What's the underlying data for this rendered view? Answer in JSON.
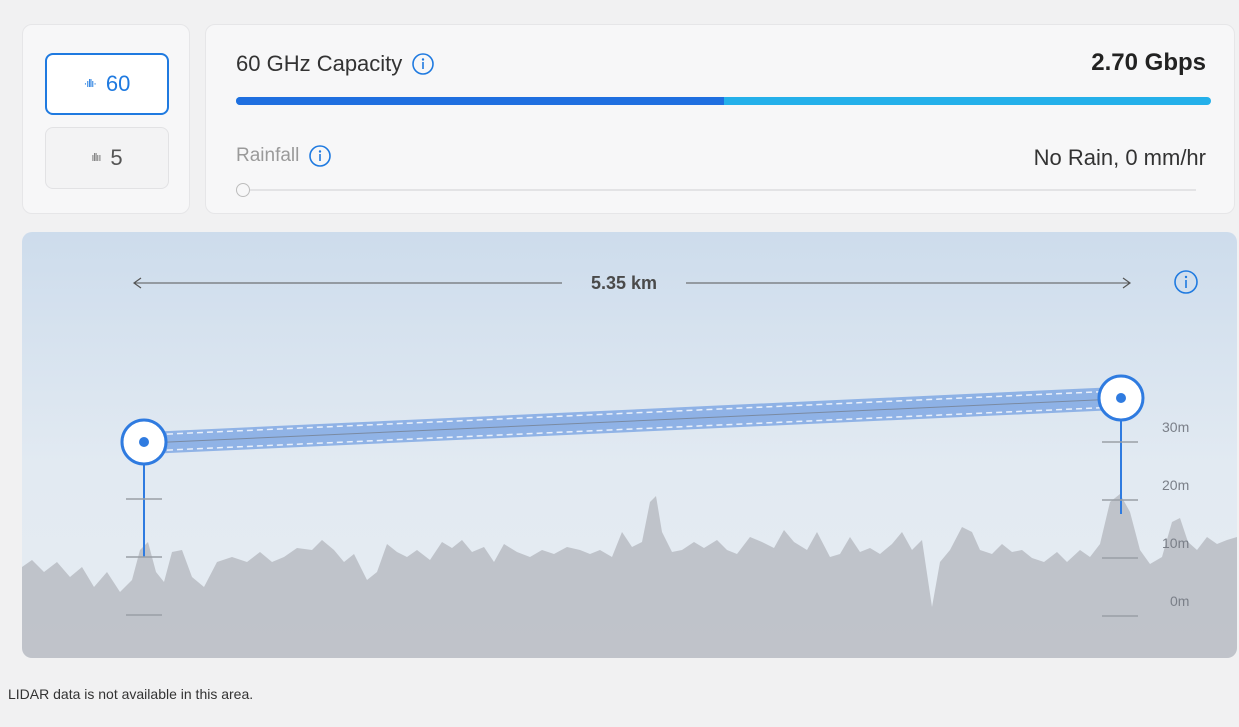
{
  "bands": {
    "band_60": {
      "label": "60",
      "icon": "signal-wave-icon",
      "selected": true
    },
    "band_5": {
      "label": "5",
      "icon": "signal-wave-icon",
      "selected": false
    }
  },
  "capacity": {
    "title": "60 GHz Capacity",
    "value": "2.70 Gbps",
    "bar_primary_fraction": 0.5
  },
  "rainfall": {
    "title": "Rainfall",
    "value": "No Rain, 0 mm/hr",
    "slider_fraction": 0
  },
  "profile": {
    "distance": "5.35 km",
    "height_labels": [
      "30m",
      "20m",
      "10m",
      "0m"
    ]
  },
  "footnote": "LIDAR data is not available in this area.",
  "colors": {
    "accent": "#1f7ae0",
    "bar_primary": "#1f6fe0",
    "bar_secondary": "#24b0ea",
    "terrain": "#b8bcc3"
  }
}
